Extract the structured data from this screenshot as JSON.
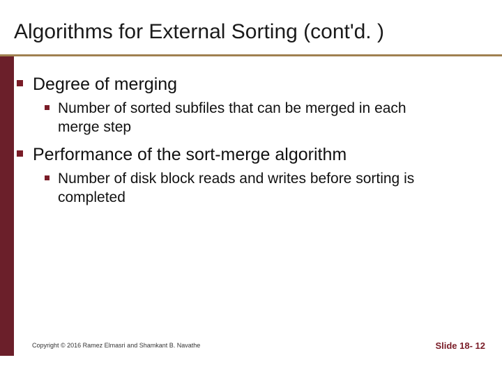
{
  "title": "Algorithms for External Sorting (cont'd. )",
  "bullets": {
    "b1": "Degree of merging",
    "b1_1": "Number of sorted subfiles that can be merged in each merge step",
    "b2": "Performance of the sort-merge algorithm",
    "b2_1": "Number of disk block reads and writes before sorting is completed"
  },
  "footer": {
    "copyright": "Copyright © 2016 Ramez Elmasri and Shamkant B. Navathe",
    "slide": "Slide 18- 12"
  }
}
